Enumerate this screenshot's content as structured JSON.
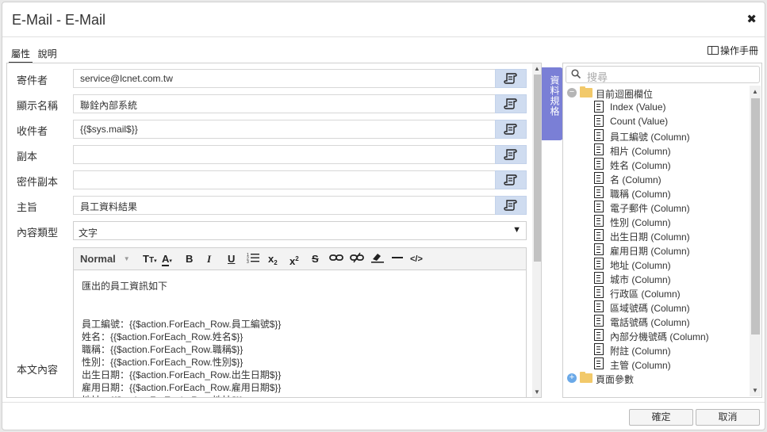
{
  "window": {
    "title": "E-Mail - E-Mail"
  },
  "tabs": [
    {
      "label": "屬性",
      "active": true
    },
    {
      "label": "說明",
      "active": false
    }
  ],
  "manual": {
    "label": "操作手冊"
  },
  "form": {
    "fields": [
      {
        "label": "寄件者",
        "value": "service@lcnet.com.tw"
      },
      {
        "label": "顯示名稱",
        "value": "聯銓內部系統"
      },
      {
        "label": "收件者",
        "value": "{{$sys.mail$}}"
      },
      {
        "label": "副本",
        "value": ""
      },
      {
        "label": "密件副本",
        "value": ""
      },
      {
        "label": "主旨",
        "value": "員工資料結果"
      }
    ],
    "content_type": {
      "label": "內容類型",
      "value": "文字"
    },
    "body_label": "本文內容"
  },
  "editor": {
    "format_label": "Normal",
    "body_lines": [
      "匯出的員工資訊如下",
      "",
      "",
      "員工編號：{{$action.ForEach_Row.員工編號$}}",
      "姓名：{{$action.ForEach_Row.姓名$}}",
      "職稱：{{$action.ForEach_Row.職稱$}}",
      "性別：{{$action.ForEach_Row.性別$}}",
      "出生日期：{{$action.ForEach_Row.出生日期$}}",
      "雇用日期：{{$action.ForEach_Row.雇用日期$}}",
      "地址：{{$action.ForEach_Row.地址$}}"
    ]
  },
  "side_tab": {
    "label": "資料規格"
  },
  "tree": {
    "search_placeholder": "搜尋",
    "root": {
      "label": "目前迴圈欄位",
      "expanded": true
    },
    "items": [
      "Index (Value)",
      "Count (Value)",
      "員工編號 (Column)",
      "相片 (Column)",
      "姓名 (Column)",
      "名 (Column)",
      "職稱 (Column)",
      "電子郵件 (Column)",
      "性別 (Column)",
      "出生日期 (Column)",
      "雇用日期 (Column)",
      "地址 (Column)",
      "城市 (Column)",
      "行政區 (Column)",
      "區域號碼 (Column)",
      "電話號碼 (Column)",
      "內部分機號碼 (Column)",
      "附註 (Column)",
      "主管 (Column)"
    ],
    "second_root": {
      "label": "頁面參數",
      "expanded": false
    }
  },
  "footer": {
    "ok_label": "確定",
    "cancel_label": "取消"
  },
  "colors": {
    "accent": "#7a7fd6",
    "expr_button": "#cfdcf0",
    "folder": "#f2c96a"
  }
}
